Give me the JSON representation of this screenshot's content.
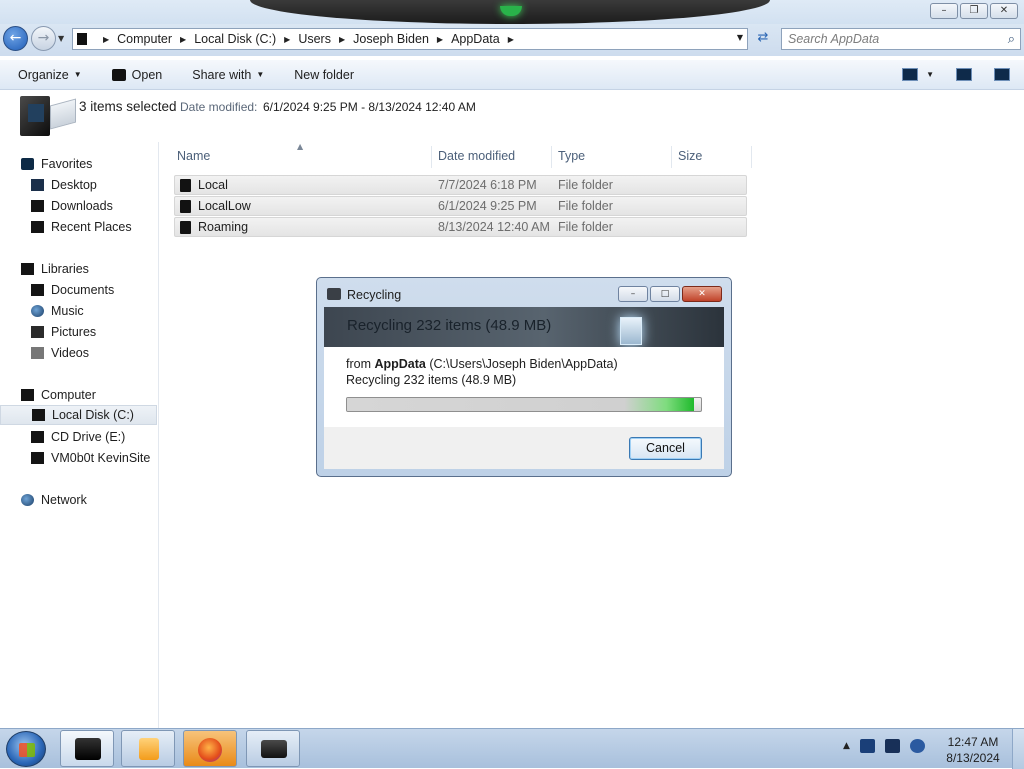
{
  "window": {
    "caption_buttons": [
      "minimize",
      "restore",
      "close"
    ]
  },
  "address_bar": {
    "segments": [
      "Computer",
      "Local Disk (C:)",
      "Users",
      "Joseph Biden",
      "AppData"
    ],
    "search_placeholder": "Search AppData"
  },
  "toolbar": {
    "organize_label": "Organize",
    "open_label": "Open",
    "share_label": "Share with",
    "new_folder_label": "New folder"
  },
  "details_pane": {
    "selection": "3 items selected",
    "date_label": "Date modified:",
    "date_value": "6/1/2024 9:25 PM - 8/13/2024 12:40 AM"
  },
  "nav_pane": {
    "favorites": "Favorites",
    "favorites_items": [
      "Desktop",
      "Downloads",
      "Recent Places"
    ],
    "libraries": "Libraries",
    "libraries_items": [
      "Documents",
      "Music",
      "Pictures",
      "Videos"
    ],
    "computer": "Computer",
    "computer_items": [
      "Local Disk (C:)",
      "CD Drive (E:)",
      "VM0b0t KevinSite"
    ],
    "network": "Network"
  },
  "file_list": {
    "columns": [
      "Name",
      "Date modified",
      "Type",
      "Size"
    ],
    "rows": [
      {
        "name": "Local",
        "date": "7/7/2024 6:18 PM",
        "type": "File folder"
      },
      {
        "name": "LocalLow",
        "date": "6/1/2024 9:25 PM",
        "type": "File folder"
      },
      {
        "name": "Roaming",
        "date": "8/13/2024 12:40 AM",
        "type": "File folder"
      }
    ]
  },
  "dialog": {
    "title": "Recycling",
    "banner": "Recycling 232 items (48.9 MB)",
    "from_prefix": "from ",
    "from_name": "AppData",
    "from_path": " (C:\\Users\\Joseph Biden\\AppData)",
    "status": "Recycling 232 items (48.9 MB)",
    "progress_fraction": 0.98,
    "cancel_label": "Cancel"
  },
  "taskbar": {
    "time": "12:47 AM",
    "date": "8/13/2024"
  },
  "colors": {
    "accent": "#1f5db7",
    "progress_green": "#1fba2c"
  }
}
